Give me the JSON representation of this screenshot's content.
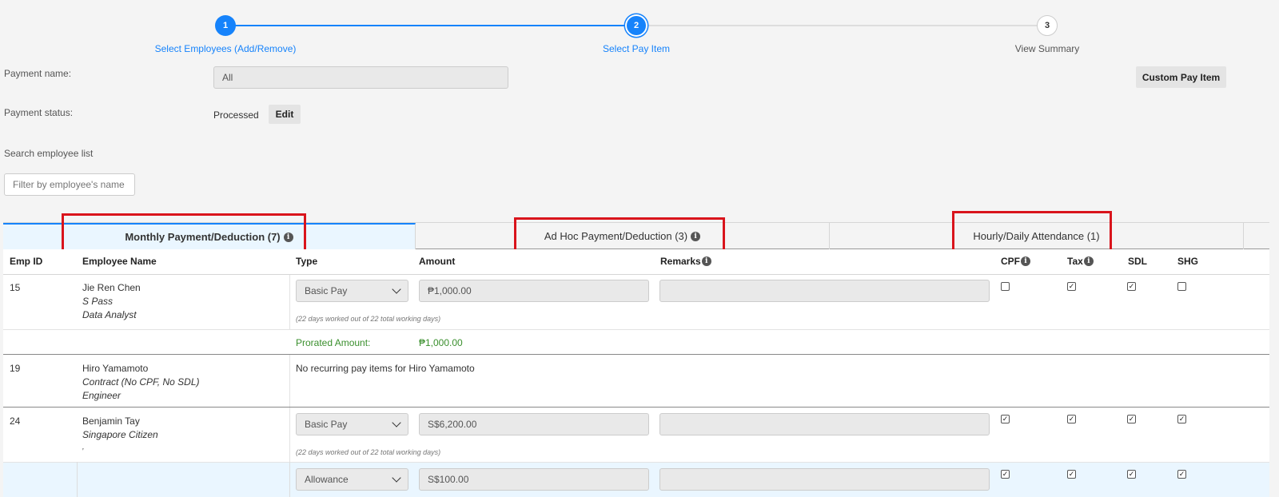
{
  "stepper": {
    "steps": [
      {
        "number": "1",
        "label": "Select Employees (Add/Remove)",
        "state": "done"
      },
      {
        "number": "2",
        "label": "Select Pay Item",
        "state": "current"
      },
      {
        "number": "3",
        "label": "View Summary",
        "state": "todo"
      }
    ]
  },
  "form": {
    "payment_name_label": "Payment name:",
    "payment_name_value": "All",
    "payment_status_label": "Payment status:",
    "payment_status_value": "Processed",
    "edit_label": "Edit",
    "custom_pay_item_label": "Custom Pay Item",
    "search_label": "Search employee list",
    "search_placeholder": "Filter by employee's name o"
  },
  "tabs": [
    {
      "label": "Monthly Payment/Deduction (7)",
      "active": true,
      "info": true
    },
    {
      "label": "Ad Hoc Payment/Deduction (3)",
      "active": false,
      "info": true
    },
    {
      "label": "Hourly/Daily Attendance (1)",
      "active": false,
      "info": false
    }
  ],
  "table": {
    "headers": {
      "emp_id": "Emp ID",
      "name": "Employee Name",
      "type": "Type",
      "amount": "Amount",
      "remarks": "Remarks",
      "cpf": "CPF",
      "tax": "Tax",
      "sdl": "SDL",
      "shg": "SHG"
    },
    "rows": [
      {
        "id": "15",
        "name": "Jie Ren Chen",
        "pass": "S Pass",
        "title": "Data Analyst",
        "type": "Basic Pay",
        "amount": "₱1,000.00",
        "remarks": "",
        "note": "(22 days worked out of 22 total working days)",
        "prorated_label": "Prorated Amount:",
        "prorated_value": "₱1,000.00",
        "cpf": false,
        "tax": true,
        "sdl": true,
        "shg": false
      },
      {
        "id": "19",
        "name": "Hiro Yamamoto",
        "pass": "Contract (No CPF, No SDL)",
        "title": "Engineer",
        "message": "No recurring pay items for Hiro Yamamoto"
      },
      {
        "id": "24",
        "name": "Benjamin Tay",
        "pass": "Singapore Citizen",
        "title": ",",
        "type": "Basic Pay",
        "amount": "S$6,200.00",
        "remarks": "",
        "note": "(22 days worked out of 22 total working days)",
        "cpf": true,
        "tax": true,
        "sdl": true,
        "shg": true
      },
      {
        "type": "Allowance",
        "amount": "S$100.00",
        "remarks": "",
        "cpf": true,
        "tax": true,
        "sdl": true,
        "shg": true
      }
    ]
  },
  "colors": {
    "accent": "#1683fb",
    "highlight_box": "#d9141c",
    "prorated_text": "#3a8f2d",
    "active_tab_bg": "#e6f4ff"
  }
}
